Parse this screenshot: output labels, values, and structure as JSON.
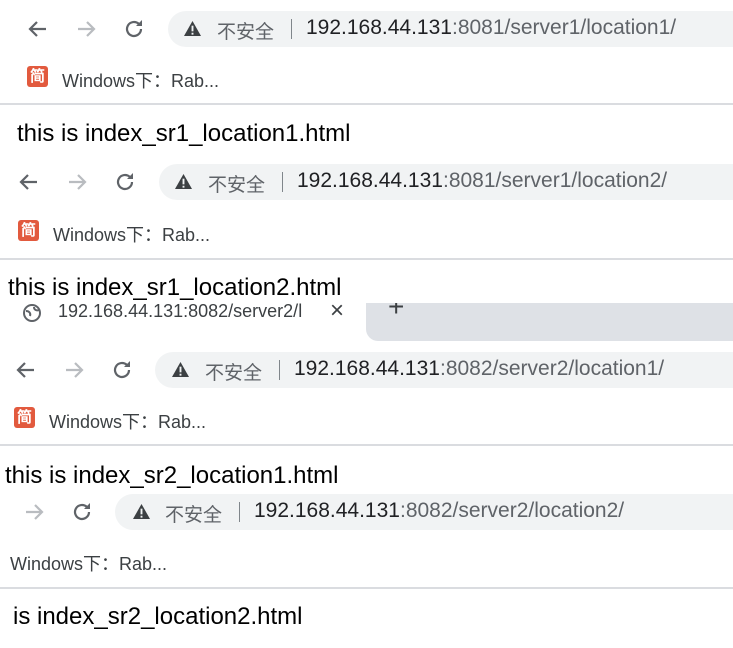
{
  "colors": {
    "toolbar": "#f1f3f4",
    "bookmark_icon": "#e25a3e",
    "divider": "#dadce0"
  },
  "icons": [
    "back-arrow-icon",
    "forward-arrow-icon",
    "reload-icon",
    "warning-icon",
    "bookmark-favicon",
    "globe-icon",
    "close-icon",
    "plus-icon"
  ],
  "panels": [
    {
      "security": "不安全",
      "host": "192.168.44.131",
      "url_rest": ":8081/server1/location1/",
      "bookmark_icon_text": "简",
      "bookmark": "Windows下：Rab...",
      "content": "this is index_sr1_location1.html"
    },
    {
      "security": "不安全",
      "host": "192.168.44.131",
      "url_rest": ":8081/server1/location2/",
      "bookmark_icon_text": "简",
      "bookmark": "Windows下：Rab...",
      "content": "this is index_sr1_location2.html"
    },
    {
      "tab_title": "192.168.44.131:8082/server2/l",
      "plus": "+",
      "close": "×",
      "security": "不安全",
      "host": "192.168.44.131",
      "url_rest": ":8082/server2/location1/",
      "bookmark_icon_text": "简",
      "bookmark": "Windows下：Rab...",
      "content": "this is index_sr2_location1.html"
    },
    {
      "security": "不安全",
      "host": "192.168.44.131",
      "url_rest": ":8082/server2/location2/",
      "bookmark": "Windows下：Rab...",
      "content": "is index_sr2_location2.html"
    }
  ]
}
